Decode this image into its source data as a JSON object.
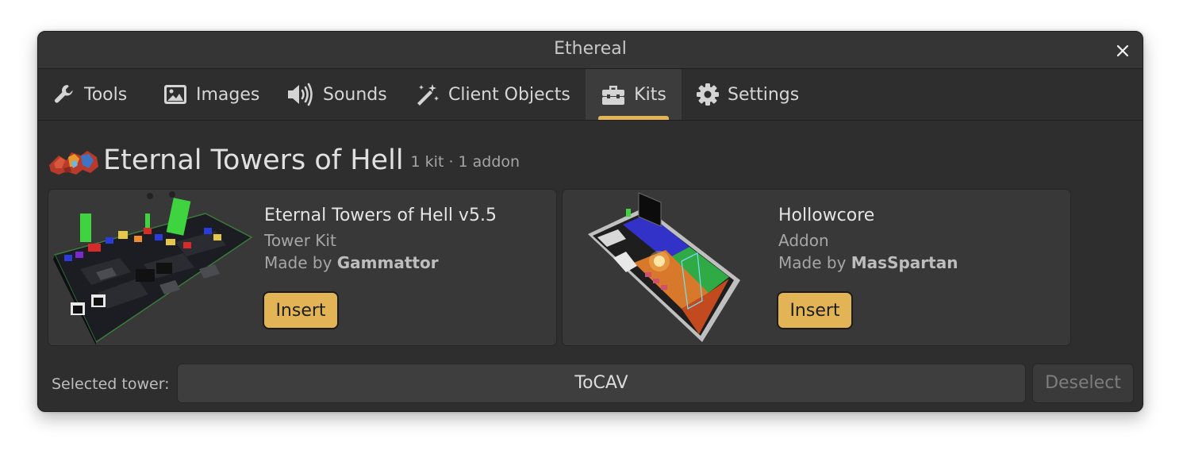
{
  "window": {
    "title": "Ethereal",
    "close_icon": "close-icon"
  },
  "tabs": [
    {
      "label": "Tools",
      "icon": "wrench-icon",
      "active": false
    },
    {
      "label": "Images",
      "icon": "image-icon",
      "active": false
    },
    {
      "label": "Sounds",
      "icon": "speaker-icon",
      "active": false
    },
    {
      "label": "Client Objects",
      "icon": "magic-wand-icon",
      "active": false
    },
    {
      "label": "Kits",
      "icon": "toolbox-icon",
      "active": true
    },
    {
      "label": "Settings",
      "icon": "gear-icon",
      "active": false
    }
  ],
  "section": {
    "title": "Eternal Towers of Hell",
    "meta": "1 kit · 1 addon",
    "logo": "etoh-logo"
  },
  "kits": [
    {
      "name": "Eternal Towers of Hell v5.5",
      "type": "Tower Kit",
      "made_by_prefix": "Made by",
      "author": "Gammattor",
      "button": "Insert",
      "thumbnail": "tower-kit-thumbnail"
    },
    {
      "name": "Hollowcore",
      "type": "Addon",
      "made_by_prefix": "Made by",
      "author": "MasSpartan",
      "button": "Insert",
      "thumbnail": "addon-thumbnail"
    }
  ],
  "footer": {
    "label": "Selected tower:",
    "selected_tower": "ToCAV",
    "deselect_label": "Deselect"
  },
  "colors": {
    "accent": "#e2b456",
    "window_bg": "#2e2e2e",
    "card_bg": "#383838",
    "active_tab_bg": "#3c3c3c"
  }
}
